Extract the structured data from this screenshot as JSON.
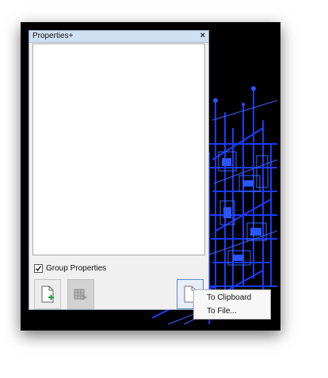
{
  "window": {
    "title": "Properties+",
    "close_glyph": "×"
  },
  "options": {
    "group_properties_label": "Group Properties",
    "group_properties_checked": true
  },
  "toolbar": {
    "buttons": [
      {
        "name": "new-document-button",
        "icon": "document-add-icon",
        "state": "enabled"
      },
      {
        "name": "export-table-button",
        "icon": "table-export-icon",
        "state": "disabled"
      },
      {
        "name": "copy-export-button",
        "icon": "document-icon",
        "state": "active"
      }
    ]
  },
  "context_menu": {
    "items": [
      {
        "label": "To Clipboard"
      },
      {
        "label": "To File..."
      }
    ]
  },
  "colors": {
    "viewport_bg": "#000000",
    "wireframe": "#1a3cff",
    "title_bar": "#cfe0f3",
    "add_accent": "#1f9a3a"
  }
}
